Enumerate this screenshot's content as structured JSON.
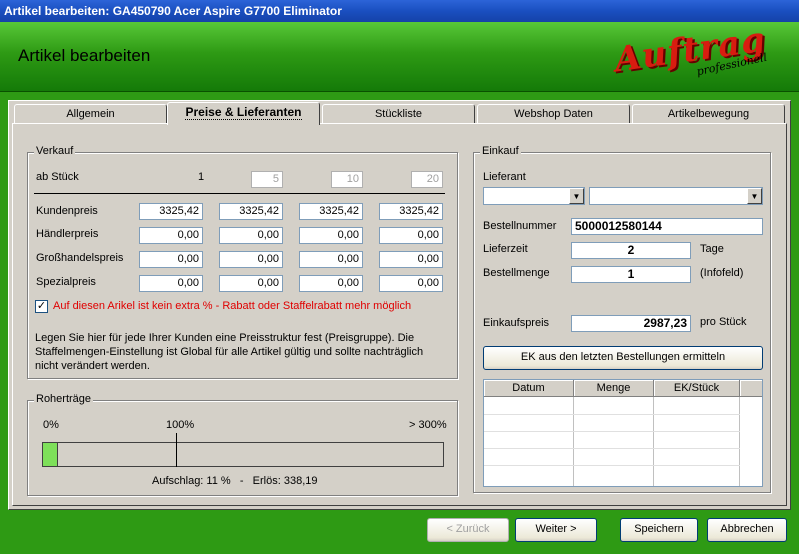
{
  "window": {
    "title": "Artikel bearbeiten: GA450790 Acer Aspire G7700 Eliminator"
  },
  "header": {
    "title": "Artikel bearbeiten",
    "logo_main": "Auftrag",
    "logo_sub": "professionell"
  },
  "tabs": [
    {
      "label": "Allgemein"
    },
    {
      "label": "Preise & Lieferanten"
    },
    {
      "label": "Stückliste"
    },
    {
      "label": "Webshop Daten"
    },
    {
      "label": "Artikelbewegung"
    }
  ],
  "active_tab": "Preise & Lieferanten",
  "verkauf": {
    "legend": "Verkauf",
    "ab_stueck_label": "ab Stück",
    "ab_stueck": [
      "1",
      "5",
      "10",
      "20"
    ],
    "rows": [
      {
        "label": "Kundenpreis",
        "values": [
          "3325,42",
          "3325,42",
          "3325,42",
          "3325,42"
        ]
      },
      {
        "label": "Händlerpreis",
        "values": [
          "0,00",
          "0,00",
          "0,00",
          "0,00"
        ]
      },
      {
        "label": "Großhandelspreis",
        "values": [
          "0,00",
          "0,00",
          "0,00",
          "0,00"
        ]
      },
      {
        "label": "Spezialpreis",
        "values": [
          "0,00",
          "0,00",
          "0,00",
          "0,00"
        ]
      }
    ],
    "checkbox_checked": true,
    "checkbox_label": "Auf diesen Arikel ist kein extra % - Rabatt oder Staffelrabatt mehr möglich",
    "info_text": "Legen Sie hier für jede Ihrer Kunden eine Preisstruktur fest (Preisgruppe). Die Staffelmengen-Einstellung ist Global für alle Artikel gültig und sollte nachträglich nicht verändert werden."
  },
  "rohertraege": {
    "legend": "Roherträge",
    "label_0": "0%",
    "label_100": "100%",
    "label_300": "> 300%",
    "fill_percent_of_300": 3.7,
    "bar_color": "#7ee05a",
    "summary": "Aufschlag: 11 %   -   Erlös: 338,19"
  },
  "einkauf": {
    "legend": "Einkauf",
    "lieferant_label": "Lieferant",
    "bestellnummer_label": "Bestellnummer",
    "bestellnummer": "5000012580144",
    "lieferzeit_label": "Lieferzeit",
    "lieferzeit": "2",
    "lieferzeit_unit": "Tage",
    "bestellmenge_label": "Bestellmenge",
    "bestellmenge": "1",
    "bestellmenge_unit": "(Infofeld)",
    "einkaufspreis_label": "Einkaufspreis",
    "einkaufspreis": "2987,23",
    "einkaufspreis_unit": "pro Stück",
    "ek_button": "EK aus den letzten Bestellungen ermitteln",
    "grid_columns": [
      "Datum",
      "Menge",
      "EK/Stück"
    ]
  },
  "footer": {
    "back": "< Zurück",
    "next": "Weiter >",
    "save": "Speichern",
    "cancel": "Abbrechen"
  }
}
